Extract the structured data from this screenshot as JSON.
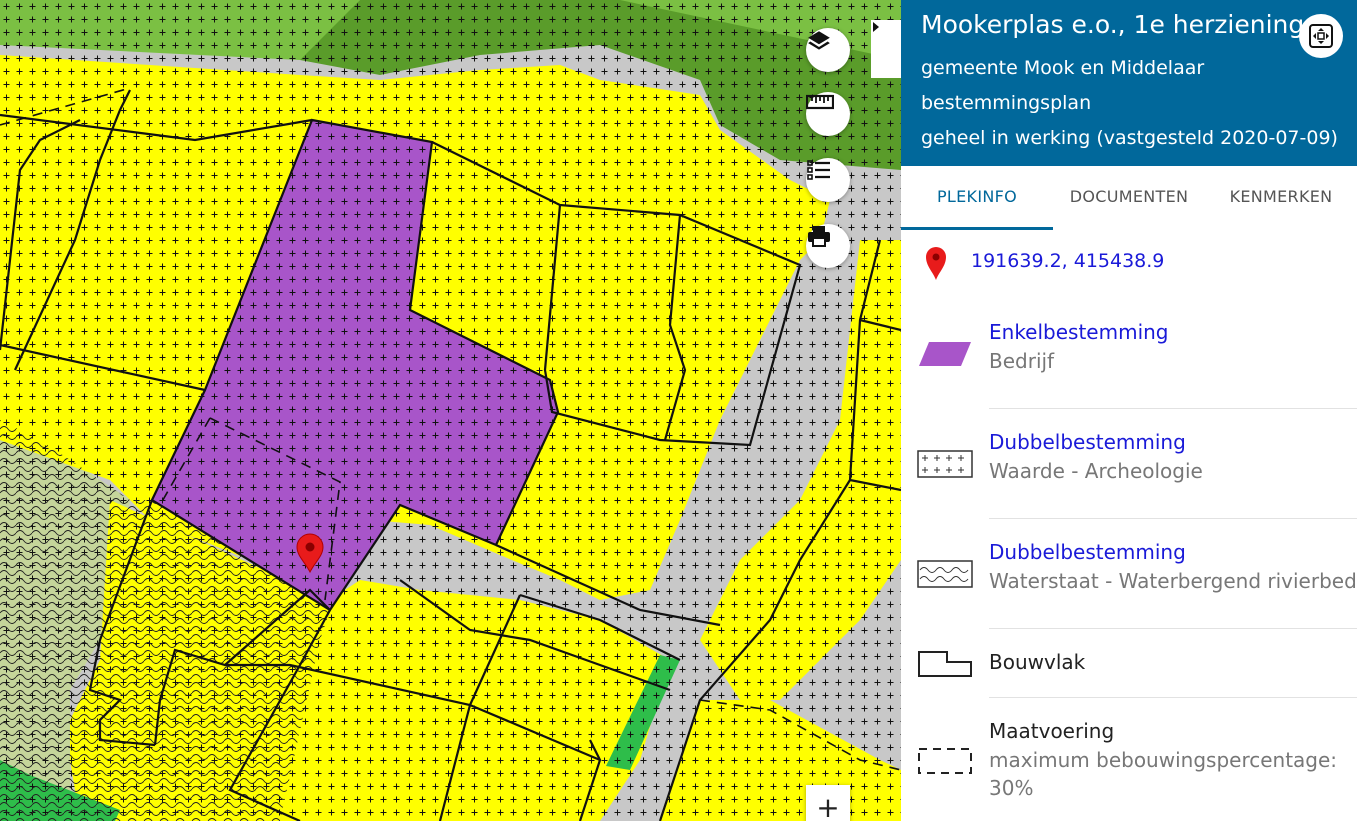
{
  "map": {
    "zoom_in_label": "+",
    "buttons": [
      "layers-icon",
      "ruler-icon",
      "legend-list-icon",
      "print-icon"
    ],
    "colors": {
      "yellow": "#ffff00",
      "purple": "#a855c9",
      "grey": "#c8c8c8",
      "green_light": "#7bc043",
      "green_dark": "#5a9c2a",
      "green_bright": "#2ebd4a",
      "olive": "#c5d59a"
    }
  },
  "panel": {
    "title": "Mookerplas e.o., 1e herziening",
    "municipality": "gemeente Mook en Middelaar",
    "plan_type": "bestemmingsplan",
    "status": "geheel in werking (vastgesteld 2020-07-09)",
    "tabs": [
      {
        "label": "PLEKINFO",
        "active": true
      },
      {
        "label": "DOCUMENTEN",
        "active": false
      },
      {
        "label": "KENMERKEN",
        "active": false
      }
    ],
    "coordinates": "191639.2, 415438.9",
    "legend": [
      {
        "title": "Enkelbestemming",
        "subtitle": "Bedrijf",
        "symbol": "purple-parallelogram-icon"
      },
      {
        "title": "Dubbelbestemming",
        "subtitle": "Waarde - Archeologie",
        "symbol": "cross-hatch-icon"
      },
      {
        "title": "Dubbelbestemming",
        "subtitle": "Waterstaat - Waterbergend rivierbed",
        "symbol": "wave-pattern-icon"
      },
      {
        "title": "Bouwvlak",
        "subtitle": "",
        "symbol": "building-plane-icon"
      },
      {
        "title": "Maatvoering",
        "subtitle": "maximum bebouwingspercentage:",
        "subtitle2": "30%",
        "symbol": "dashed-rect-icon"
      }
    ]
  }
}
